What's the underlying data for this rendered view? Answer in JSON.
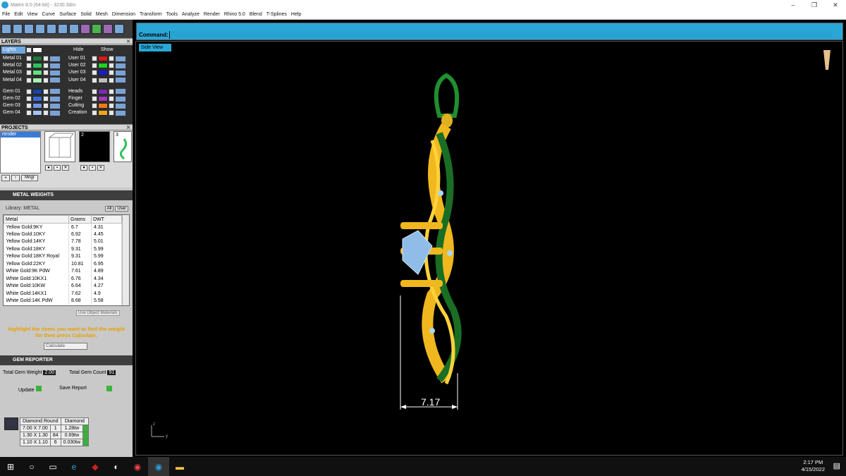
{
  "window": {
    "title": "Matrix 8.0 (64-bit) - 3230.3dm",
    "controls": [
      "–",
      "❐",
      "✕"
    ]
  },
  "menu": [
    "File",
    "Edit",
    "View",
    "Curve",
    "Surface",
    "Solid",
    "Mesh",
    "Dimension",
    "Transform",
    "Tools",
    "Analyze",
    "Render",
    "Rhino 5.0",
    "Blend",
    "T-Splines",
    "Help"
  ],
  "layers": {
    "title": "LAYERS",
    "lights_label": "Lights",
    "hide_label": "Hide",
    "show_label": "Show",
    "left": [
      {
        "name": "Metal 01",
        "color": "#1f7a3a"
      },
      {
        "name": "Metal 02",
        "color": "#2fc15a"
      },
      {
        "name": "Metal 03",
        "color": "#64e07d"
      },
      {
        "name": "Metal 04",
        "color": "#a8f0b7"
      },
      {
        "name": "Gem 01",
        "color": "#1446a8"
      },
      {
        "name": "Gem 02",
        "color": "#3d6ad6"
      },
      {
        "name": "Gem 03",
        "color": "#6f95e6"
      },
      {
        "name": "Gem 04",
        "color": "#a6c2f2"
      }
    ],
    "right": [
      {
        "name": "User 01",
        "color": "#d61a1a"
      },
      {
        "name": "User 02",
        "color": "#1fd11f"
      },
      {
        "name": "User 03",
        "color": "#1a1ad6"
      },
      {
        "name": "User 04",
        "color": "#bdbdbd"
      },
      {
        "name": "Heads",
        "color": "#7a2ab3"
      },
      {
        "name": "Finger",
        "color": "#a03ab8"
      },
      {
        "name": "Cutting",
        "color": "#f07a1a"
      },
      {
        "name": "Creation",
        "color": "#f0a51a"
      }
    ]
  },
  "projects": {
    "title": "PROJECTS",
    "items": [
      "render"
    ],
    "thumb_numbers": [
      "2",
      "3"
    ],
    "mngr_label": "Mngr"
  },
  "metal_weights": {
    "title": "METAL WEIGHTS",
    "library": "Library: METAL",
    "filter_labels": [
      "All",
      "User"
    ],
    "columns": [
      "Metal",
      "Grams",
      "DWT"
    ],
    "rows": [
      [
        "Yellow Gold:9KY",
        "6.7",
        "4.31"
      ],
      [
        "Yellow Gold:10KY",
        "6.92",
        "4.45"
      ],
      [
        "Yellow Gold:14KY",
        "7.78",
        "5.01"
      ],
      [
        "Yellow Gold:18KY",
        "9.31",
        "5.99"
      ],
      [
        "Yellow Gold:18KY Royal",
        "9.31",
        "5.99"
      ],
      [
        "Yellow Gold:22KY",
        "10.81",
        "6.95"
      ],
      [
        "White Gold:9K PdW",
        "7.61",
        "4.89"
      ],
      [
        "White Gold:10KX1",
        "6.76",
        "4.34"
      ],
      [
        "White Gold:10KW",
        "6.64",
        "4.27"
      ],
      [
        "White Gold:14KX1",
        "7.62",
        "4.9"
      ],
      [
        "White Gold:14K PdW",
        "8.68",
        "5.58"
      ]
    ],
    "use_object_materials": "Use Object Materials",
    "note": "Highlight the items you want to find the weight for then press Calculate.",
    "calculate_label": "Calculate"
  },
  "gem_reporter": {
    "title": "GEM REPORTER",
    "total_weight_label": "Total Gem Weight",
    "total_weight": "2.00",
    "total_count_label": "Total Gem Count",
    "total_count": "91",
    "update_label": "Update",
    "save_label": "Save Report",
    "gem_columns": [
      "Diamond Round",
      "Diamond"
    ],
    "gems": [
      [
        "7.00 X 7.00",
        "1",
        "1.28tw"
      ],
      [
        "1.30 X 1.30",
        "84",
        "0.69tw"
      ],
      [
        "1.10 X 1.10",
        "6",
        "0.030tw"
      ]
    ]
  },
  "command": {
    "label": "Command:"
  },
  "viewport": {
    "view_name": "Side View",
    "dimension": "7.17",
    "axis_z": "z",
    "axis_y": "y"
  },
  "taskbar": {
    "time": "2:17 PM",
    "date": "4/15/2022"
  }
}
